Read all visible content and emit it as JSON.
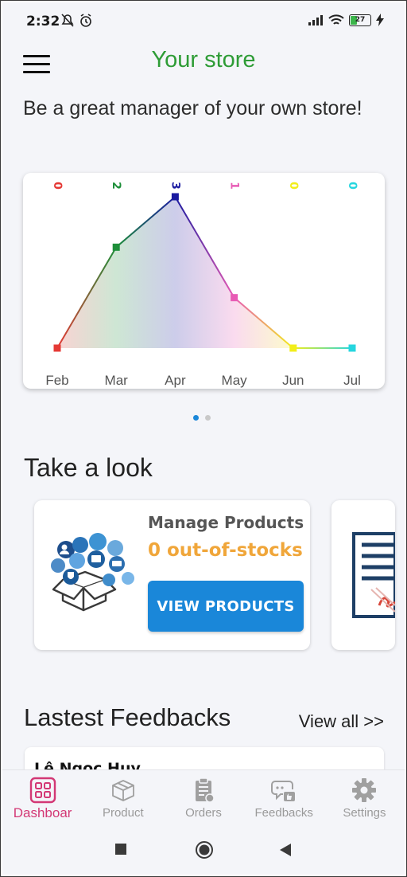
{
  "status_bar": {
    "time": "2:32",
    "battery": "27",
    "icons": [
      "notifications-off-icon",
      "alarm-icon",
      "signal-icon",
      "wifi-icon",
      "battery-icon",
      "charging-icon"
    ]
  },
  "header": {
    "title": "Your store",
    "menu_icon": "hamburger-menu-icon"
  },
  "tagline": "Be a great manager of your own store!",
  "chart_data": {
    "type": "line",
    "categories": [
      "Feb",
      "Mar",
      "Apr",
      "May",
      "Jun",
      "Jul"
    ],
    "values": [
      0,
      2,
      3,
      1,
      0,
      0
    ],
    "value_labels": [
      "0",
      "2",
      "3",
      "1",
      "0",
      "0"
    ],
    "point_colors": [
      "#e53935",
      "#1e8f3a",
      "#1a1aa0",
      "#e85bb5",
      "#f2ee1a",
      "#26d6df"
    ],
    "ylim": [
      0,
      3
    ],
    "grid": false,
    "legend": "none",
    "gradient_fill": true
  },
  "carousel": {
    "pages": 2,
    "active": 0,
    "active_color": "#1a87d9",
    "inactive_color": "#c9c9c9"
  },
  "take_a_look": {
    "title": "Take a look",
    "cards": [
      {
        "title": "Manage Products",
        "subtitle": "0 out-of-stocks",
        "button": "VIEW PRODUCTS",
        "illustration": "products-box-illustration"
      },
      {
        "illustration": "orders-document-illustration"
      }
    ]
  },
  "feedbacks": {
    "title": "Lastest Feedbacks",
    "view_all": "View all >>",
    "items": [
      {
        "name": "Lê Ngọc Huy"
      }
    ]
  },
  "bottom_nav": {
    "active_color": "#d33875",
    "items": [
      {
        "label": "Dashboar",
        "icon": "dashboard-icon",
        "active": true
      },
      {
        "label": "Product",
        "icon": "product-box-icon",
        "active": false
      },
      {
        "label": "Orders",
        "icon": "orders-clipboard-icon",
        "active": false
      },
      {
        "label": "Feedbacks",
        "icon": "feedback-chat-icon",
        "active": false
      },
      {
        "label": "Settings",
        "icon": "gear-icon",
        "active": false
      }
    ]
  },
  "system_nav": [
    "recents-icon",
    "home-icon",
    "back-icon"
  ]
}
